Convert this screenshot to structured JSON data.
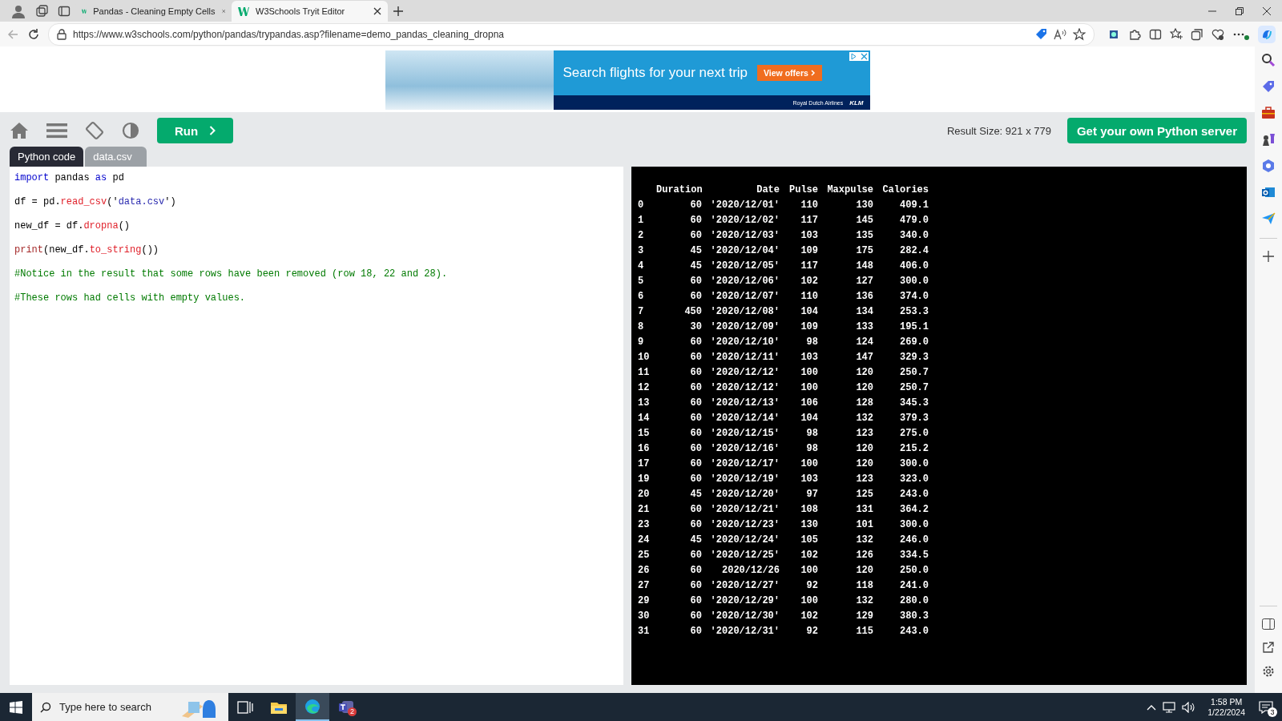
{
  "browser": {
    "tabs": [
      {
        "title": "Pandas - Cleaning Empty Cells",
        "selected": false
      },
      {
        "title": "W3Schools Tryit Editor",
        "selected": true
      }
    ],
    "url": "https://www.w3schools.com/python/pandas/trypandas.asp?filename=demo_pandas_cleaning_dropna"
  },
  "ad": {
    "headline": "Search flights for your next trip",
    "button": "View offers",
    "brand_line": "Royal Dutch Airlines",
    "logo": "KLM"
  },
  "toolbar": {
    "run_button": "Run",
    "result_size": "Result Size: 921 x 779",
    "server_button": "Get your own Python server"
  },
  "editor_tabs": [
    {
      "label": "Python code",
      "selected": true
    },
    {
      "label": "data.csv",
      "selected": false
    }
  ],
  "code_lines": [
    [
      {
        "kind": "keyword",
        "text": "import"
      },
      {
        "kind": "plain",
        "text": " pandas "
      },
      {
        "kind": "keyword",
        "text": "as"
      },
      {
        "kind": "plain",
        "text": " pd"
      }
    ],
    [
      {
        "kind": "plain",
        "text": "df = pd."
      },
      {
        "kind": "func",
        "text": "read_csv"
      },
      {
        "kind": "plain",
        "text": "('"
      },
      {
        "kind": "string",
        "text": "data.csv"
      },
      {
        "kind": "plain",
        "text": "')"
      }
    ],
    [
      {
        "kind": "plain",
        "text": "new_df = df."
      },
      {
        "kind": "func",
        "text": "dropna"
      },
      {
        "kind": "plain",
        "text": "()"
      }
    ],
    [
      {
        "kind": "builtin",
        "text": "print"
      },
      {
        "kind": "plain",
        "text": "(new_df."
      },
      {
        "kind": "func",
        "text": "to_string"
      },
      {
        "kind": "plain",
        "text": "())"
      }
    ],
    [
      {
        "kind": "comment",
        "text": "#Notice in the result that some rows have been removed (row 18, 22 and 28)."
      }
    ],
    [
      {
        "kind": "comment",
        "text": "#These rows had cells with empty values."
      }
    ]
  ],
  "result": {
    "columns": [
      "Duration",
      "Date",
      "Pulse",
      "Maxpulse",
      "Calories"
    ],
    "rows": [
      {
        "index": "0",
        "cells": [
          "60",
          "'2020/12/01'",
          "110",
          "130",
          "409.1"
        ]
      },
      {
        "index": "1",
        "cells": [
          "60",
          "'2020/12/02'",
          "117",
          "145",
          "479.0"
        ]
      },
      {
        "index": "2",
        "cells": [
          "60",
          "'2020/12/03'",
          "103",
          "135",
          "340.0"
        ]
      },
      {
        "index": "3",
        "cells": [
          "45",
          "'2020/12/04'",
          "109",
          "175",
          "282.4"
        ]
      },
      {
        "index": "4",
        "cells": [
          "45",
          "'2020/12/05'",
          "117",
          "148",
          "406.0"
        ]
      },
      {
        "index": "5",
        "cells": [
          "60",
          "'2020/12/06'",
          "102",
          "127",
          "300.0"
        ]
      },
      {
        "index": "6",
        "cells": [
          "60",
          "'2020/12/07'",
          "110",
          "136",
          "374.0"
        ]
      },
      {
        "index": "7",
        "cells": [
          "450",
          "'2020/12/08'",
          "104",
          "134",
          "253.3"
        ]
      },
      {
        "index": "8",
        "cells": [
          "30",
          "'2020/12/09'",
          "109",
          "133",
          "195.1"
        ]
      },
      {
        "index": "9",
        "cells": [
          "60",
          "'2020/12/10'",
          "98",
          "124",
          "269.0"
        ]
      },
      {
        "index": "10",
        "cells": [
          "60",
          "'2020/12/11'",
          "103",
          "147",
          "329.3"
        ]
      },
      {
        "index": "11",
        "cells": [
          "60",
          "'2020/12/12'",
          "100",
          "120",
          "250.7"
        ]
      },
      {
        "index": "12",
        "cells": [
          "60",
          "'2020/12/12'",
          "100",
          "120",
          "250.7"
        ]
      },
      {
        "index": "13",
        "cells": [
          "60",
          "'2020/12/13'",
          "106",
          "128",
          "345.3"
        ]
      },
      {
        "index": "14",
        "cells": [
          "60",
          "'2020/12/14'",
          "104",
          "132",
          "379.3"
        ]
      },
      {
        "index": "15",
        "cells": [
          "60",
          "'2020/12/15'",
          "98",
          "123",
          "275.0"
        ]
      },
      {
        "index": "16",
        "cells": [
          "60",
          "'2020/12/16'",
          "98",
          "120",
          "215.2"
        ]
      },
      {
        "index": "17",
        "cells": [
          "60",
          "'2020/12/17'",
          "100",
          "120",
          "300.0"
        ]
      },
      {
        "index": "19",
        "cells": [
          "60",
          "'2020/12/19'",
          "103",
          "123",
          "323.0"
        ]
      },
      {
        "index": "20",
        "cells": [
          "45",
          "'2020/12/20'",
          "97",
          "125",
          "243.0"
        ]
      },
      {
        "index": "21",
        "cells": [
          "60",
          "'2020/12/21'",
          "108",
          "131",
          "364.2"
        ]
      },
      {
        "index": "23",
        "cells": [
          "60",
          "'2020/12/23'",
          "130",
          "101",
          "300.0"
        ]
      },
      {
        "index": "24",
        "cells": [
          "45",
          "'2020/12/24'",
          "105",
          "132",
          "246.0"
        ]
      },
      {
        "index": "25",
        "cells": [
          "60",
          "'2020/12/25'",
          "102",
          "126",
          "334.5"
        ]
      },
      {
        "index": "26",
        "cells": [
          "60",
          "2020/12/26",
          "100",
          "120",
          "250.0"
        ]
      },
      {
        "index": "27",
        "cells": [
          "60",
          "'2020/12/27'",
          "92",
          "118",
          "241.0"
        ]
      },
      {
        "index": "29",
        "cells": [
          "60",
          "'2020/12/29'",
          "100",
          "132",
          "280.0"
        ]
      },
      {
        "index": "30",
        "cells": [
          "60",
          "'2020/12/30'",
          "102",
          "129",
          "380.3"
        ]
      },
      {
        "index": "31",
        "cells": [
          "60",
          "'2020/12/31'",
          "92",
          "115",
          "243.0"
        ]
      }
    ]
  },
  "taskbar": {
    "search_placeholder": "Type here to search",
    "teams_badge": "2",
    "time": "1:58 PM",
    "date": "1/22/2024",
    "notification_count": "3"
  }
}
